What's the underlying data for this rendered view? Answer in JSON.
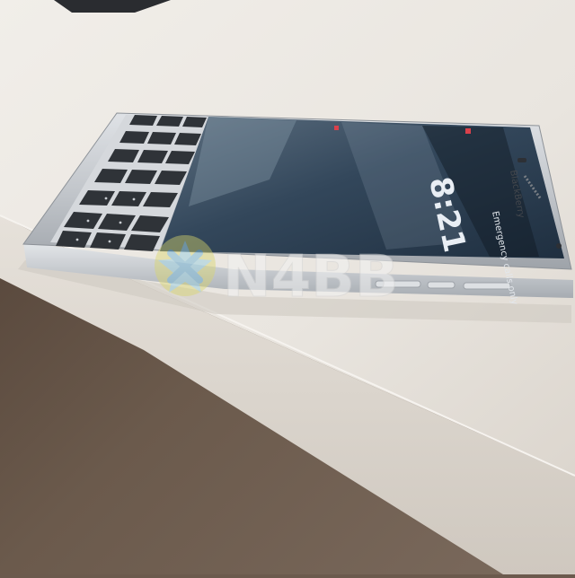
{
  "photo": {
    "subject": "phone with physical keyboard lying on a desk, lock screen on",
    "colors": {
      "desk_top": "#ece9e4",
      "desk_edge": "#ddd8d1",
      "floor": "#5d4c40",
      "device_frame": "#c9ccd0",
      "keyboard_keys": "#2f3338",
      "screen": "#2c3e52"
    }
  },
  "screen": {
    "clock": "8:21",
    "brand": "BlackBerry",
    "emergency_label": "Emergency calls only",
    "notification_icon": "notification-bell-icon",
    "signal_icon": "signal-icon"
  },
  "watermark": {
    "text": "N4BB",
    "logo_icon": "n4bb-star-logo-icon"
  }
}
